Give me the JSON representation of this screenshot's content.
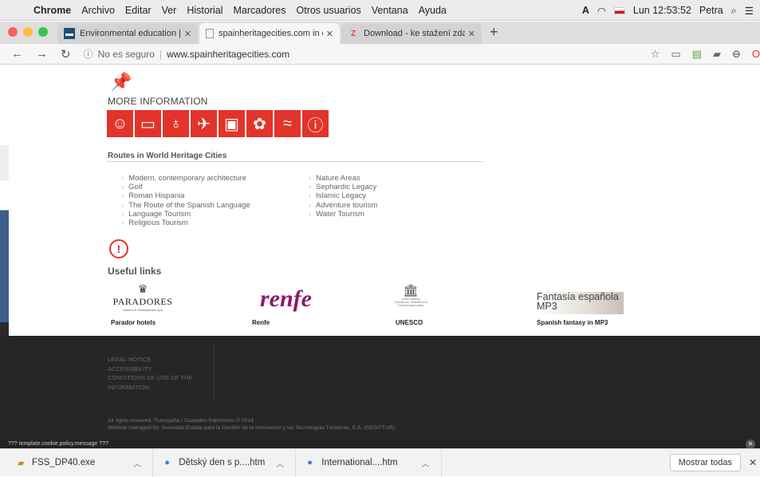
{
  "menubar": {
    "app": "Chrome",
    "items": [
      "Archivo",
      "Editar",
      "Ver",
      "Historial",
      "Marcadores",
      "Otros usuarios",
      "Ventana",
      "Ayuda"
    ],
    "clock": "Lun 12:53:52",
    "user": "Petra"
  },
  "tabs": [
    {
      "title": "Environmental education | Wad",
      "active": false
    },
    {
      "title": "spainheritagecities.com in eng",
      "active": true
    },
    {
      "title": "Download - ke stažení zdarma",
      "active": false
    }
  ],
  "toolbar": {
    "security": "No es seguro",
    "url": "www.spainheritagecities.com"
  },
  "page": {
    "more_info": "MORE INFORMATION",
    "icons": [
      "theatre-icon",
      "bed-icon",
      "tree-icon",
      "sport-icon",
      "bus-icon",
      "food-icon",
      "water-icon",
      "info-icon"
    ],
    "routes_title": "Routes in World Heritage Cities",
    "routes_col1": [
      "Modern, contemporary architecture",
      "Golf",
      "Roman Hispania",
      "The Route of the Spanish Language",
      "Language Tourism",
      "Religious Tourism"
    ],
    "routes_col2": [
      "Nature Areas",
      "Sephardic Legacy",
      "Islamic Legacy",
      "Adventure tourism",
      "Water Tourism"
    ],
    "useful_links": "Useful links",
    "parador_logo": "PARADORES",
    "parador_sub": "Hoteles & Restaurantes spA",
    "renfe_logo": "renfe",
    "fantasia_logo": "Fantasía española MP3",
    "unesco_sub": "United Nations Educational, Scientific and Cultural Organization",
    "captions": {
      "parador": "Parador hotels",
      "renfe": "Renfe",
      "unesco": "UNESCO",
      "fantasia": "Spanish fantasy in MP3"
    },
    "footer_links": [
      "LEGAL NOTICE",
      "ACCESSIBILITY",
      "CONDITIONS OF USE OF THE",
      "INFORMATION"
    ],
    "copyright": "All rights reserved. Turespaña / Ciudades Patrimonio © 2014",
    "managed_by": "Website managed by: Sociedad Estatal para la Gestión de la Innovación y las Tecnologías Turísticas, S.A. (SEGITTUR)",
    "cookie": "??? template.cookie.policy.message ???"
  },
  "downloads": {
    "items": [
      "FSS_DP40.exe",
      "Dětský den s p....htm",
      "International....htm"
    ],
    "show_all": "Mostrar todas"
  },
  "colors": {
    "accent": "#e2342b",
    "renfe": "#8a1a6e",
    "footer": "#262626"
  }
}
